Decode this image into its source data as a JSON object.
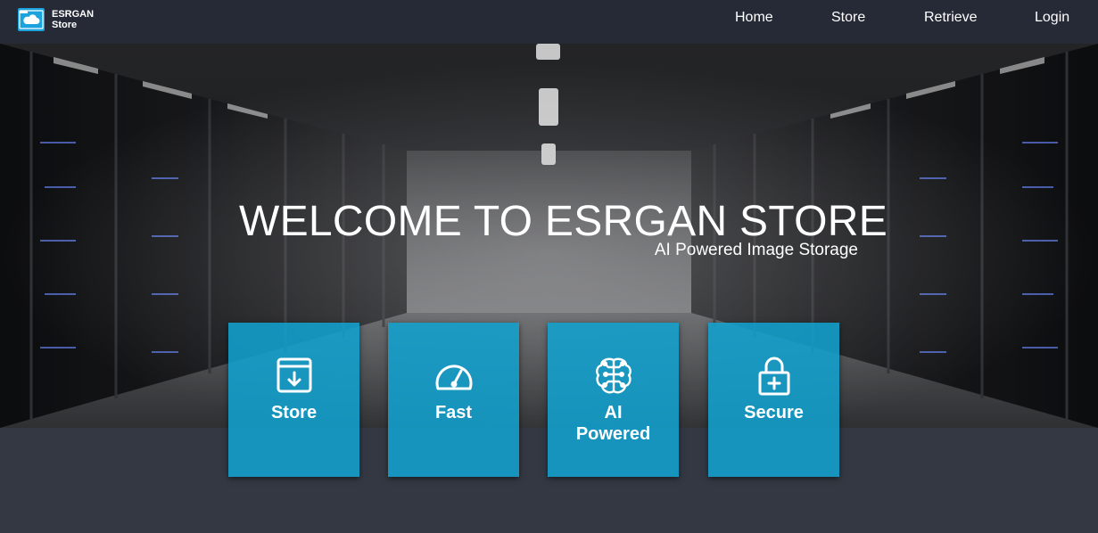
{
  "brand": {
    "line1": "ESRGAN",
    "line2": "Store",
    "logo_icon": "cloud-storage-icon"
  },
  "nav": {
    "home": "Home",
    "store": "Store",
    "retrieve": "Retrieve",
    "login": "Login"
  },
  "hero": {
    "title": "WELCOME TO ESRGAN STORE",
    "subtitle": "AI Powered Image Storage",
    "background": "server-room-image"
  },
  "features": [
    {
      "label": "Store",
      "icon": "archive-download-icon"
    },
    {
      "label": "Fast",
      "icon": "speedometer-icon"
    },
    {
      "label": "AI\nPowered",
      "icon": "brain-circuit-icon"
    },
    {
      "label": "Secure",
      "icon": "lock-plus-icon"
    }
  ],
  "colors": {
    "navbar": "#252a36",
    "card": "#12a0ce",
    "page_bg": "#343843"
  }
}
